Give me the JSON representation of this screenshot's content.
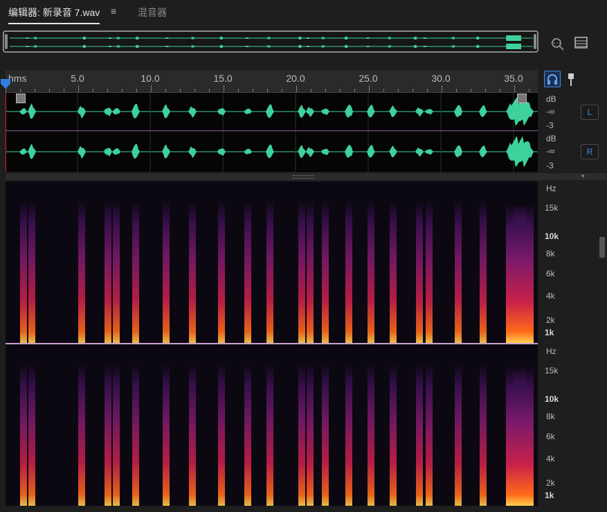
{
  "tabs": {
    "editor_label": "编辑器: 新录音 7.wav",
    "mixer_label": "混音器"
  },
  "icons": {
    "menu": "hamburger-icon",
    "zoom": "zoom-icon",
    "panel": "panel-list-icon",
    "headphones": "headphones-icon",
    "pin": "marker-pin-icon"
  },
  "ruler": {
    "unit_label": "hms",
    "labels": [
      "5.0",
      "10.0",
      "15.0",
      "20.0",
      "25.0",
      "30.0",
      "35.0"
    ]
  },
  "channels": {
    "left": {
      "badge": "L",
      "db": "dB",
      "inf": "-∞",
      "neg3": "-3"
    },
    "right": {
      "badge": "R",
      "db": "-∞",
      "neg3": "-3",
      "top": "dB"
    }
  },
  "spectral": {
    "unit": "Hz",
    "labels": [
      "15k",
      "10k",
      "8k",
      "6k",
      "4k",
      "2k",
      "1k"
    ]
  },
  "colors": {
    "waveform": "#3fd19a",
    "accent_blue": "#3d8ee8",
    "spectro_hot": "#ff6a1a"
  }
}
